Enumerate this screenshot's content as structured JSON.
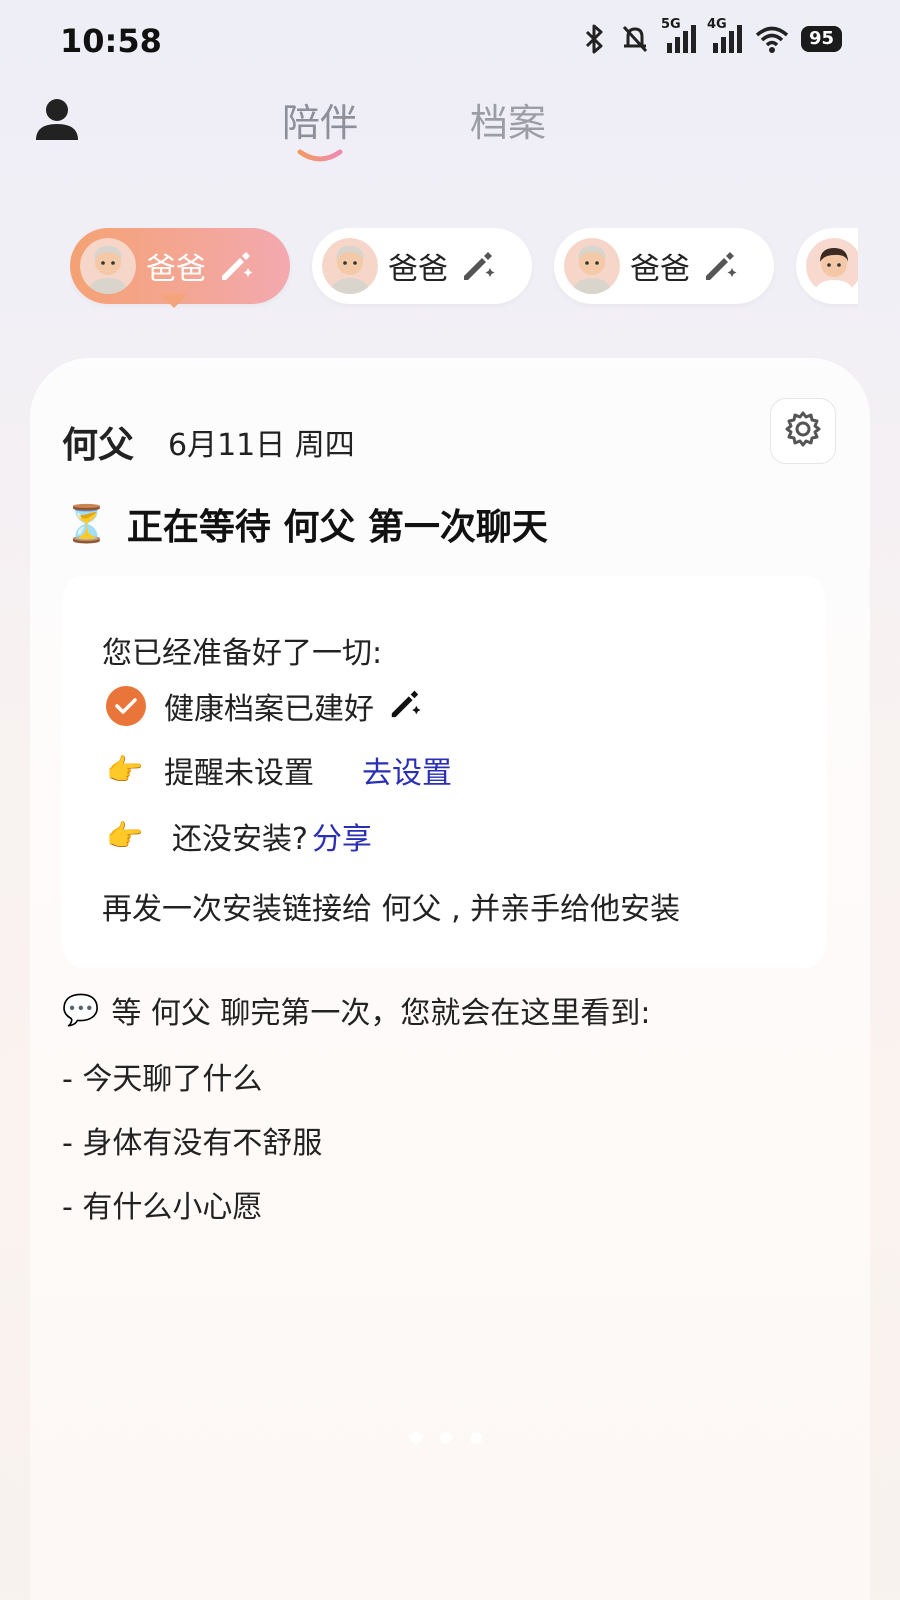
{
  "status_bar": {
    "time": "10:58",
    "network_1": "5G",
    "network_2": "4G",
    "battery": "95"
  },
  "header": {
    "tabs": [
      {
        "label": "陪伴",
        "active": true
      },
      {
        "label": "档案",
        "active": false
      }
    ]
  },
  "chips": [
    {
      "label": "爸爸",
      "active": true,
      "avatar": "elderly-man-avatar"
    },
    {
      "label": "爸爸",
      "active": false,
      "avatar": "elderly-man-avatar"
    },
    {
      "label": "爸爸",
      "active": false,
      "avatar": "elderly-man-avatar"
    },
    {
      "label": "",
      "active": false,
      "avatar": "young-man-avatar"
    }
  ],
  "card": {
    "name": "何父",
    "date": "6月11日 周四",
    "waiting_icon": "⏳",
    "waiting_text": "正在等待 何父 第一次聊天",
    "ready": {
      "title": "您已经准备好了一切:",
      "health_label": "健康档案已建好",
      "reminder_label": "提醒未设置",
      "reminder_link": "去设置",
      "install_label": "还没安装?",
      "install_link": "分享",
      "hand_icon": "👉",
      "resend_text": "再发一次安装链接给 何父 , 并亲手给他安装"
    },
    "after": {
      "icon": "💬",
      "text": "等 何父 聊完第一次，您就会在这里看到:",
      "bullets": [
        "- 今天聊了什么",
        "- 身体有没有不舒服",
        "- 有什么小心愿"
      ]
    }
  },
  "colors": {
    "accent_orange": "#e9753b",
    "link_blue": "#2b2fb4",
    "chip_gradient_start": "#f4a273",
    "chip_gradient_end": "#f3a9b0"
  }
}
